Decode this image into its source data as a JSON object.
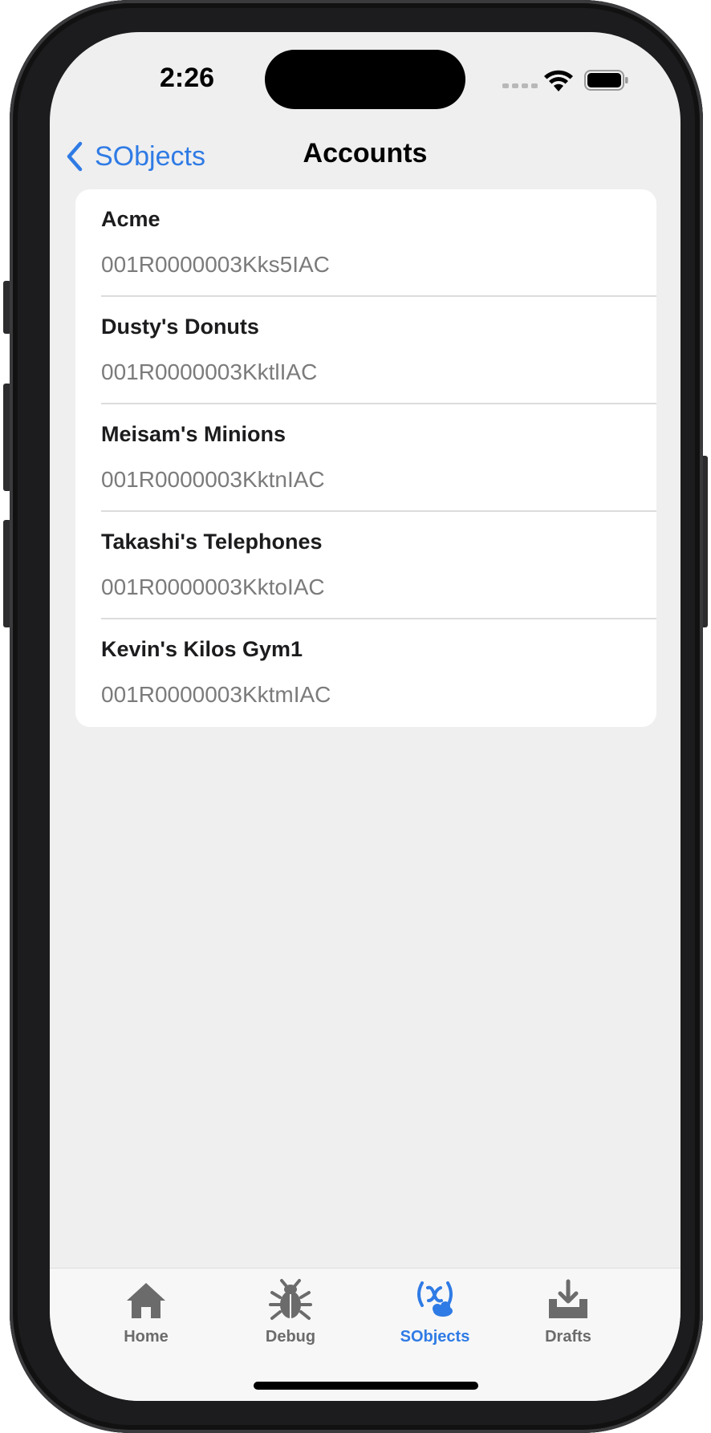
{
  "status_bar": {
    "time": "2:26"
  },
  "nav": {
    "back_label": "SObjects",
    "title": "Accounts"
  },
  "accounts": [
    {
      "name": "Acme",
      "id": "001R0000003Kks5IAC"
    },
    {
      "name": "Dusty's Donuts",
      "id": "001R0000003KktlIAC"
    },
    {
      "name": "Meisam's Minions",
      "id": "001R0000003KktnIAC"
    },
    {
      "name": "Takashi's Telephones",
      "id": "001R0000003KktoIAC"
    },
    {
      "name": "Kevin's Kilos Gym1",
      "id": "001R0000003KktmIAC"
    }
  ],
  "tabs": [
    {
      "label": "Home",
      "icon": "house-icon"
    },
    {
      "label": "Debug",
      "icon": "bug-icon"
    },
    {
      "label": "SObjects",
      "icon": "sobjects-icon",
      "active": true
    },
    {
      "label": "Drafts",
      "icon": "tray-download-icon"
    }
  ],
  "colors": {
    "accent": "#2f7be5",
    "background": "#efefef",
    "tab_inactive": "#6b6b6b"
  }
}
